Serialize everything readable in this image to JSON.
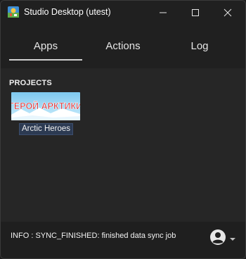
{
  "window": {
    "title": "Studio Desktop (utest)"
  },
  "tabs": [
    {
      "label": "Apps",
      "active": true
    },
    {
      "label": "Actions",
      "active": false
    },
    {
      "label": "Log",
      "active": false
    }
  ],
  "projects": {
    "section_title": "PROJECTS",
    "items": [
      {
        "name": "Arctic Heroes",
        "thumbnail_text": "ГЕРОЙ АРКТИКИ"
      }
    ]
  },
  "status": {
    "message": "INFO  : SYNC_FINISHED: finished data sync job"
  },
  "icons": {
    "app": "studio-app-icon",
    "minimize": "minimize-icon",
    "maximize": "maximize-icon",
    "close": "close-icon",
    "user": "user-account-icon",
    "dropdown": "chevron-down-icon"
  },
  "colors": {
    "background": "#202020",
    "panel": "#262626",
    "accent_underline": "#cfcfcf",
    "selected_label": "#2c3a52"
  }
}
